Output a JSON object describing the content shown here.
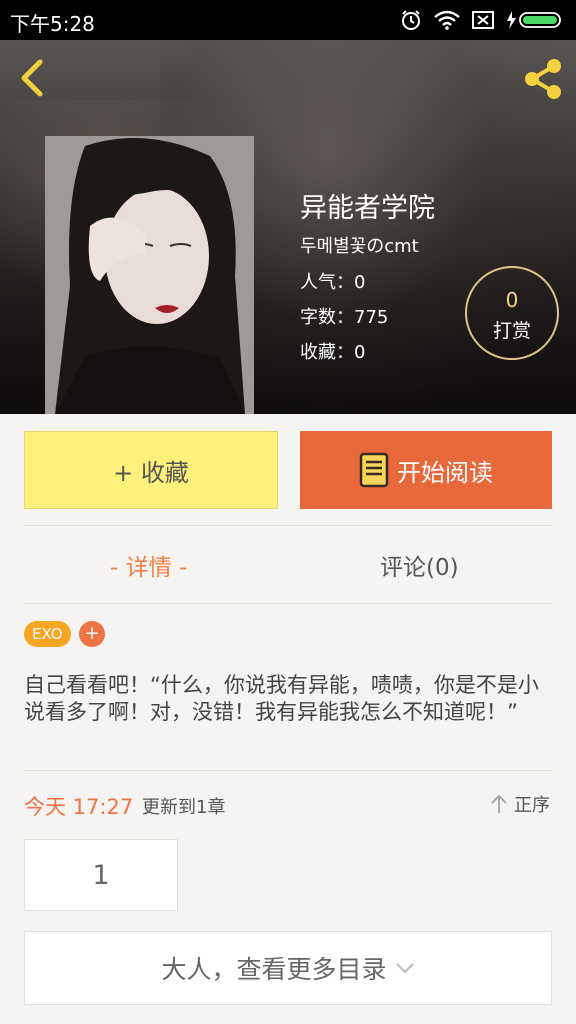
{
  "status_bar": {
    "time": "下午5:28"
  },
  "book": {
    "title": "异能者学院",
    "author": "두메별꽃のcmt",
    "popularity": "人气：0",
    "word_count": "字数：775",
    "favorites": "收藏：0"
  },
  "reward": {
    "count": "0",
    "label": "打赏"
  },
  "actions": {
    "collect_label": "+ 收藏",
    "read_label": "开始阅读"
  },
  "tabs": {
    "details": "- 详情 -",
    "comments": "评论(0)"
  },
  "tags": [
    "EXO"
  ],
  "tag_add_label": "+",
  "description": "自己看看吧！“什么，你说我有异能，啧啧，你是不是小说看多了啊！对，没错！我有异能我怎么不知道呢！”",
  "update": {
    "time": "今天 17:27",
    "text": "更新到1章",
    "sort_label": "正序"
  },
  "chapter_number": "1",
  "more_catalog_label": "大人，查看更多目录",
  "colors": {
    "accent_orange": "#e8683c",
    "tag_yellow": "#f6a623",
    "collect_yellow": "#fdf17c",
    "icon_gold": "#f4d03f"
  }
}
